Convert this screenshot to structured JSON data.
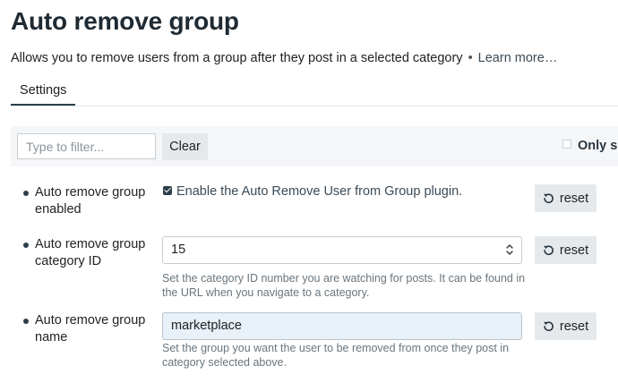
{
  "page": {
    "title": "Auto remove group",
    "description": "Allows you to remove users from a group after they post in a selected category",
    "separator": "•",
    "learn_more": "Learn more…"
  },
  "tabs": [
    {
      "label": "Settings",
      "active": true
    }
  ],
  "filter": {
    "placeholder": "Type to filter...",
    "value": "",
    "clear_label": "Clear",
    "only_show_label": "Only sh"
  },
  "settings": [
    {
      "label": "Auto remove group enabled",
      "type": "checkbox",
      "checked": true,
      "checkbox_label": "Enable the Auto Remove User from Group plugin.",
      "reset_label": "reset"
    },
    {
      "label": "Auto remove group category ID",
      "type": "number",
      "value": "15",
      "help": "Set the category ID number you are watching for posts. It can be found in the URL when you navigate to a category.",
      "reset_label": "reset"
    },
    {
      "label": "Auto remove group name",
      "type": "text",
      "value": "marketplace",
      "help": "Set the group you want the user to be removed from once they post in category selected above.",
      "reset_label": "reset"
    }
  ],
  "colors": {
    "text_dark": "#1f2a33",
    "accent": "#2c3e4a",
    "muted": "#6a757d",
    "button_bg": "#e6e9ec",
    "filter_bg": "#f4f6f8",
    "filled_input_bg": "#e8f0f8"
  },
  "icons": {
    "reset": "undo-icon",
    "stepper": "stepper-icon",
    "checkbox": "checkbox-checked"
  }
}
